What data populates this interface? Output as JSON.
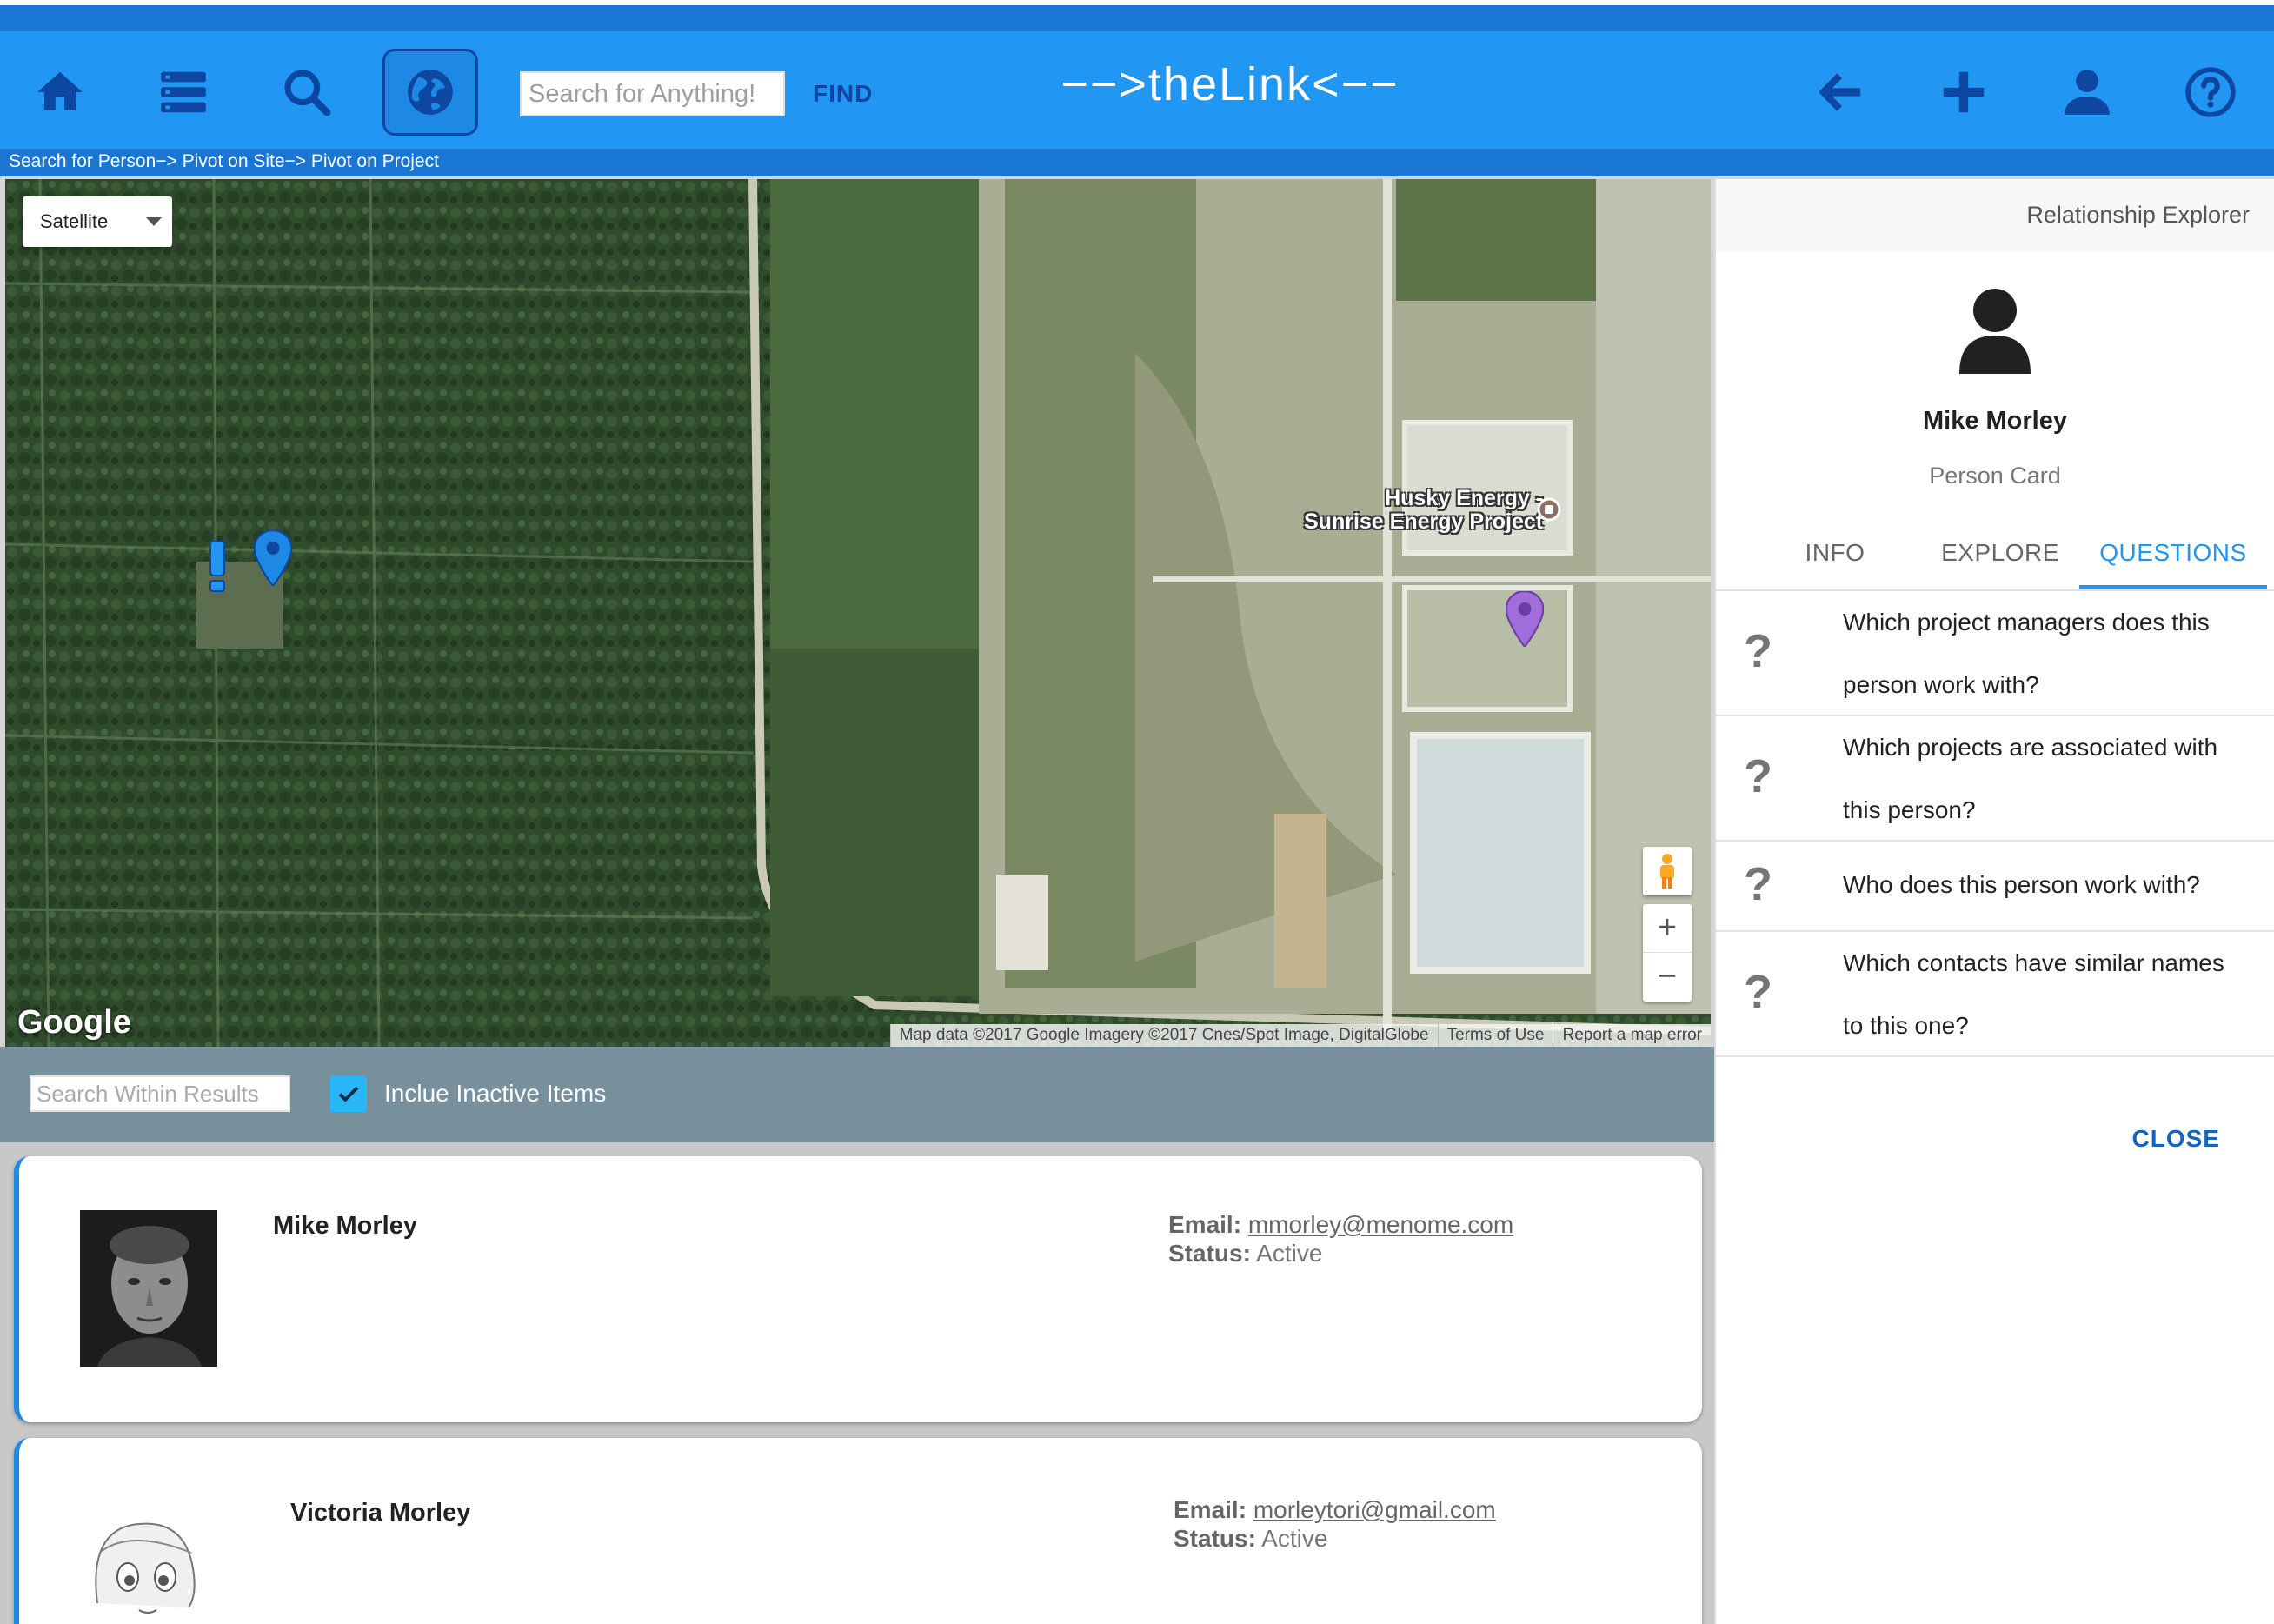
{
  "app": {
    "title": "−−>theLink<−−"
  },
  "toolbar": {
    "search_placeholder": "Search for Anything!",
    "find_label": "FIND",
    "icons": [
      "home-icon",
      "list-icon",
      "search-icon",
      "globe-icon",
      "back-arrow-icon",
      "add-icon",
      "person-icon",
      "help-icon"
    ],
    "colors": {
      "bar": "#2196f3",
      "band": "#1976d2",
      "active": "#1e88e5"
    }
  },
  "breadcrumb": "Search for Person−> Pivot on Site−> Pivot on Project",
  "map": {
    "type_select": "Satellite",
    "place_label_line1": "Husky Energy -",
    "place_label_line2": "Sunrise Energy Project",
    "logo": "Google",
    "attribution": "Map data ©2017 Google Imagery ©2017 Cnes/Spot Image, DigitalGlobe",
    "terms": "Terms of Use",
    "report": "Report a map error",
    "zoom_in": "+",
    "zoom_out": "−"
  },
  "filter": {
    "placeholder": "Search Within Results",
    "checkbox_checked": true,
    "checkbox_label": "Inclue Inactive Items"
  },
  "results": [
    {
      "name": "Mike Morley",
      "email_label": "Email:",
      "email": "mmorley@menome.com",
      "status_label": "Status:",
      "status": "Active"
    },
    {
      "name": "Victoria Morley",
      "email_label": "Email:",
      "email": "morleytori@gmail.com",
      "status_label": "Status:",
      "status": "Active"
    }
  ],
  "panel": {
    "title": "Relationship Explorer",
    "name": "Mike Morley",
    "subtitle": "Person Card",
    "tabs": [
      {
        "label": "INFO",
        "active": false
      },
      {
        "label": "EXPLORE",
        "active": false
      },
      {
        "label": "QUESTIONS",
        "active": true
      }
    ],
    "questions": [
      {
        "mark": "?",
        "text": "Which project managers does this person work with?"
      },
      {
        "mark": "?",
        "text": "Which projects are associated with this person?"
      },
      {
        "mark": "?",
        "text": "Who does this person work with?"
      },
      {
        "mark": "?",
        "text": "Which contacts have similar names to this one?"
      }
    ],
    "close_label": "CLOSE"
  }
}
